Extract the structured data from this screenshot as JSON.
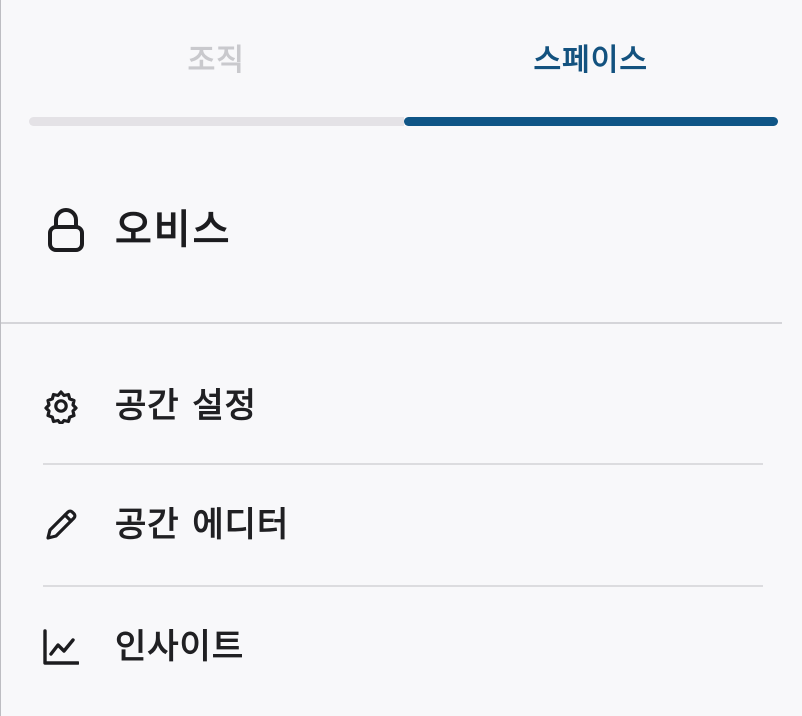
{
  "tabs": [
    {
      "label": "조직",
      "active": false
    },
    {
      "label": "스페이스",
      "active": true
    }
  ],
  "space": {
    "name": "오비스",
    "icon": "lock-icon"
  },
  "menu": {
    "items": [
      {
        "label": "공간 설정",
        "icon": "gear-icon"
      },
      {
        "label": "공간 에디터",
        "icon": "pencil-icon"
      },
      {
        "label": "인사이트",
        "icon": "line-chart-icon"
      }
    ]
  },
  "colors": {
    "accent": "#0f5586",
    "active_tab_text": "#13527f",
    "inactive_tab_text": "#c9c9cd",
    "background": "#f8f8fa"
  }
}
